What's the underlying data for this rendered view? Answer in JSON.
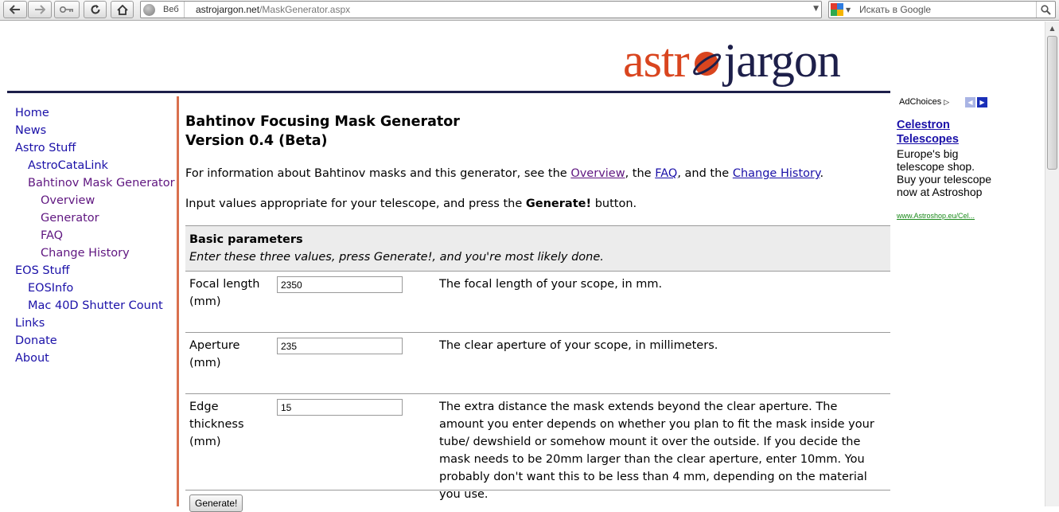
{
  "browser": {
    "address": {
      "scheme_label": "Веб",
      "host": "astrojargon.net",
      "path": "/MaskGenerator.aspx"
    },
    "search": {
      "placeholder": "Искать в Google"
    }
  },
  "logo": {
    "part1": "astr",
    "part2": "jargon"
  },
  "sidebar": {
    "items": [
      {
        "label": "Home",
        "level": 1
      },
      {
        "label": "News",
        "level": 1
      },
      {
        "label": "Astro Stuff",
        "level": 1
      },
      {
        "label": "AstroCataLink",
        "level": 2
      },
      {
        "label": "Bahtinov Mask Generator",
        "level": 2
      },
      {
        "label": "Overview",
        "level": 3
      },
      {
        "label": "Generator",
        "level": 3
      },
      {
        "label": "FAQ",
        "level": 3
      },
      {
        "label": "Change History",
        "level": 3
      },
      {
        "label": "EOS Stuff",
        "level": 1
      },
      {
        "label": "EOSInfo",
        "level": 2
      },
      {
        "label": "Mac 40D Shutter Count",
        "level": 2
      },
      {
        "label": "Links",
        "level": 1
      },
      {
        "label": "Donate",
        "level": 1
      },
      {
        "label": "About",
        "level": 1
      }
    ]
  },
  "main": {
    "title_line1": "Bahtinov Focusing Mask Generator",
    "title_line2": "Version 0.4 (Beta)",
    "intro": {
      "before": "For information about Bahtinov masks and this generator, see the ",
      "link_overview": "Overview",
      "sep1": ", the ",
      "link_faq": "FAQ",
      "sep2": ", and the ",
      "link_history": "Change History",
      "after": "."
    },
    "instructions": {
      "before": "Input values appropriate for your telescope, and press the ",
      "bold": "Generate!",
      "after": " button."
    },
    "params": {
      "heading": "Basic parameters",
      "subheading": "Enter these three values, press Generate!, and you're most likely done.",
      "rows": [
        {
          "label": "Focal length (mm)",
          "value": "2350",
          "description": "The focal length of your scope, in mm."
        },
        {
          "label": "Aperture (mm)",
          "value": "235",
          "description": "The clear aperture of your scope, in millimeters."
        },
        {
          "label": "Edge thickness (mm)",
          "value": "15",
          "description": "The extra distance the mask extends beyond the clear aperture. The amount you enter depends on whether you plan to fit the mask inside your tube/ dewshield or somehow mount it over the outside. If you decide the mask needs to be 20mm larger than the clear aperture, enter 10mm. You probably don't want this to be less than 4 mm, depending on the material you use."
        }
      ]
    },
    "generate_button": "Generate!"
  },
  "ad": {
    "adchoices": "AdChoices",
    "title": "Celestron Telescopes",
    "body": "Europe's big telescope shop. Buy your telescope now at Astroshop",
    "url": "www.Astroshop.eu/Cel..."
  },
  "colors": {
    "link": "#1a10a8",
    "visited_link": "#5f1680",
    "brand_orange": "#d9451f",
    "brand_navy": "#1d1f4a",
    "accent_rule": "#d9704e",
    "ad_url": "#1a8a1a"
  }
}
